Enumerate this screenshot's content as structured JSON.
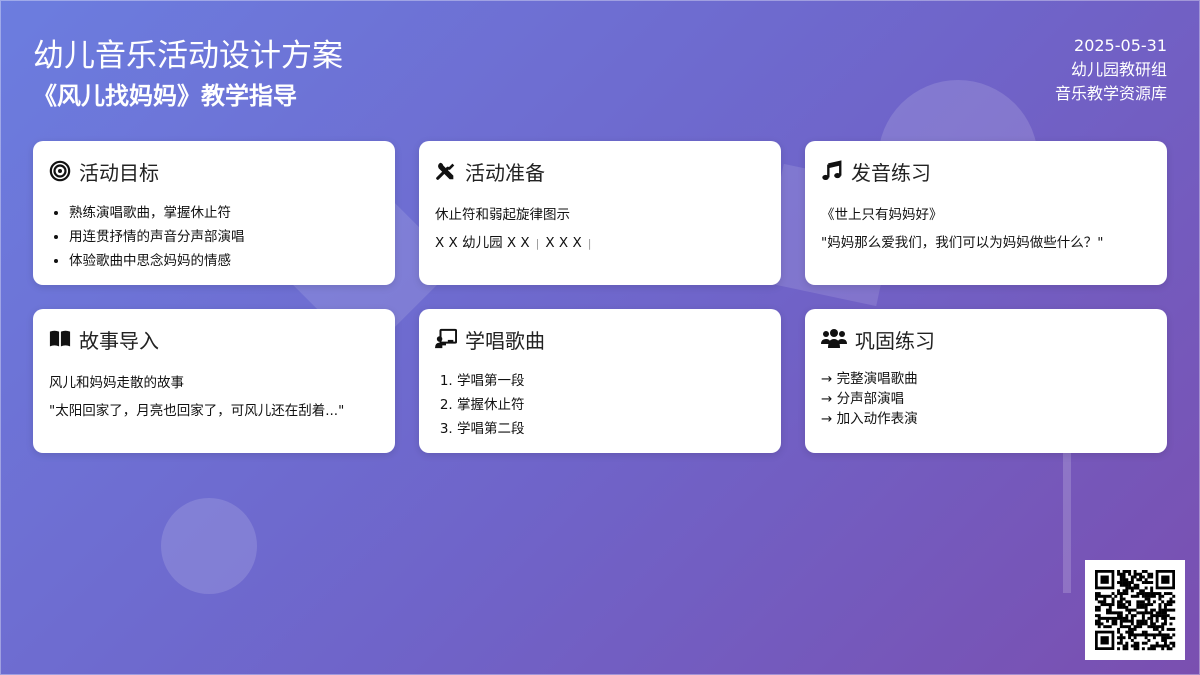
{
  "header": {
    "title": "幼儿音乐活动设计方案",
    "subtitle": "《风儿找妈妈》教学指导",
    "date": "2025-05-31",
    "org": "幼儿园教研组",
    "source": "音乐教学资源库"
  },
  "cards": {
    "goals": {
      "icon": "target-icon",
      "title": "活动目标",
      "items": [
        "熟练演唱歌曲，掌握休止符",
        "用连贯抒情的声音分声部演唱",
        "体验歌曲中思念妈妈的情感"
      ]
    },
    "prep": {
      "icon": "tools-icon",
      "title": "活动准备",
      "line1": "休止符和弱起旋律图示",
      "line2_a": "X X 幼儿园 X X",
      "line2_b": "X X X",
      "sep": "|"
    },
    "vocal": {
      "icon": "music-note-icon",
      "title": "发音练习",
      "song": "《世上只有妈妈好》",
      "quote": "\"妈妈那么爱我们，我们可以为妈妈做些什么？\""
    },
    "story": {
      "icon": "book-icon",
      "title": "故事导入",
      "line1": "风儿和妈妈走散的故事",
      "quote": "\"太阳回家了，月亮也回家了，可风儿还在刮着...\""
    },
    "learn": {
      "icon": "teacher-board-icon",
      "title": "学唱歌曲",
      "steps": [
        "学唱第一段",
        "掌握休止符",
        "学唱第二段"
      ]
    },
    "practice": {
      "icon": "users-icon",
      "title": "巩固练习",
      "items": [
        "→ 完整演唱歌曲",
        "→ 分声部演唱",
        "→ 加入动作表演"
      ]
    }
  },
  "colors": {
    "bg_start": "#6c7ddf",
    "bg_end": "#7a4fb0",
    "card": "#ffffff"
  },
  "qr": {
    "icon": "qr-code-icon"
  }
}
